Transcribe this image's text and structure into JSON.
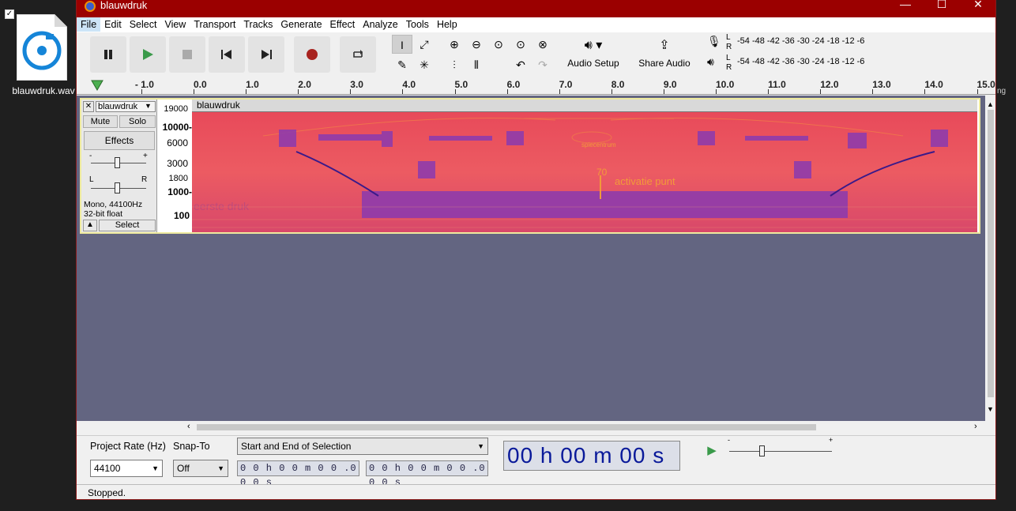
{
  "desktop": {
    "file_label": "blauwdruk.wav",
    "edge_right_text": "ng"
  },
  "window": {
    "title": "blauwdruk"
  },
  "menu": [
    "File",
    "Edit",
    "Select",
    "View",
    "Transport",
    "Tracks",
    "Generate",
    "Effect",
    "Analyze",
    "Tools",
    "Help"
  ],
  "toolbar": {
    "audio_setup": "Audio Setup",
    "share_audio": "Share Audio",
    "meter_rec_scale": "-54  -48  -42  -36  -30  -24  -18  -12   -6",
    "meter_play_scale": "-54  -48  -42  -36  -30  -24  -18  -12   -6",
    "lr_l": "L",
    "lr_r": "R"
  },
  "ruler": [
    "- 1.0",
    "0.0",
    "1.0",
    "2.0",
    "3.0",
    "4.0",
    "5.0",
    "6.0",
    "7.0",
    "8.0",
    "9.0",
    "10.0",
    "11.0",
    "12.0",
    "13.0",
    "14.0",
    "15.0"
  ],
  "track": {
    "name": "blauwdruk",
    "mute": "Mute",
    "solo": "Solo",
    "effects": "Effects",
    "gain_minus": "-",
    "gain_plus": "+",
    "pan_l": "L",
    "pan_r": "R",
    "info1": "Mono, 44100Hz",
    "info2": "32-bit float",
    "select": "Select",
    "scale": [
      "19000",
      "10000-",
      "6000",
      "3000",
      "1800",
      "1000-",
      "100"
    ],
    "clip_name": "blauwdruk",
    "spec_text1": "activatie punt",
    "spec_text2": "70",
    "spec_text3": "eerste druk",
    "spec_text4": "spiecentrum"
  },
  "bottom": {
    "project_rate_label": "Project Rate (Hz)",
    "project_rate": "44100",
    "snap_label": "Snap-To",
    "snap_value": "Off",
    "selection_mode": "Start and End of Selection",
    "start_time": "0 0 h 0 0 m 0 0 .0 0 0 s",
    "end_time": "0 0 h 0 0 m 0 0 .0 0 0 s",
    "big_time": "00 h 00 m 00 s",
    "speed_minus": "-",
    "speed_plus": "+"
  },
  "status": "Stopped.",
  "colors": {
    "titlebar": "#9b0000",
    "spectrogram": "#e8545f",
    "track_bg": "#636581"
  }
}
